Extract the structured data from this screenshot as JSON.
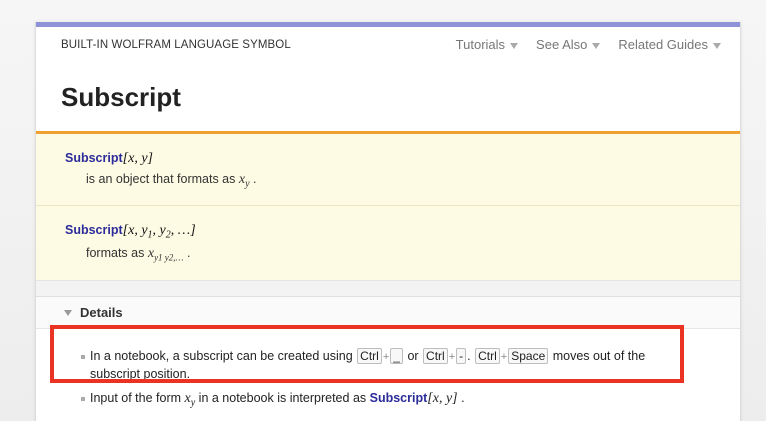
{
  "header": {
    "symbol_type": "BUILT-IN WOLFRAM LANGUAGE SYMBOL",
    "nav": [
      "Tutorials",
      "See Also",
      "Related Guides"
    ]
  },
  "title": "Subscript",
  "usage": [
    {
      "fn": "Subscript",
      "args": "[x, y]",
      "desc_prefix": "is an object that formats as",
      "desc_math": "x",
      "desc_math_sub": "y",
      "desc_suffix": "."
    },
    {
      "fn": "Subscript",
      "args": "[x, y",
      "args_sub1": "1",
      "args_mid": ", y",
      "args_sub2": "2",
      "args_end": ", …]",
      "desc_prefix": "formats as",
      "desc_math": "x",
      "desc_math_sub": "y1 y2,…",
      "desc_suffix": "."
    }
  ],
  "details": {
    "label": "Details",
    "bullets": {
      "b1_a": "In a notebook, a subscript can be created using",
      "k1": "Ctrl",
      "k2": "_",
      "or": "or",
      "k3": "Ctrl",
      "k4": "-",
      "k5": "Ctrl",
      "k6": "Space",
      "b1_b": "moves out of the subscript position.",
      "b2_a": "Input of the form",
      "b2_math": "x",
      "b2_sub": "y",
      "b2_b": "in a notebook is interpreted as",
      "b2_fn": "Subscript",
      "b2_args": "[x, y]",
      "b2_end": "."
    }
  },
  "colors": {
    "accent_bar": "#8f93d8",
    "orange_rule": "#f0a030",
    "usage_bg": "#fdfbe3",
    "link": "#2b2b9a",
    "highlight": "#ea3323"
  }
}
